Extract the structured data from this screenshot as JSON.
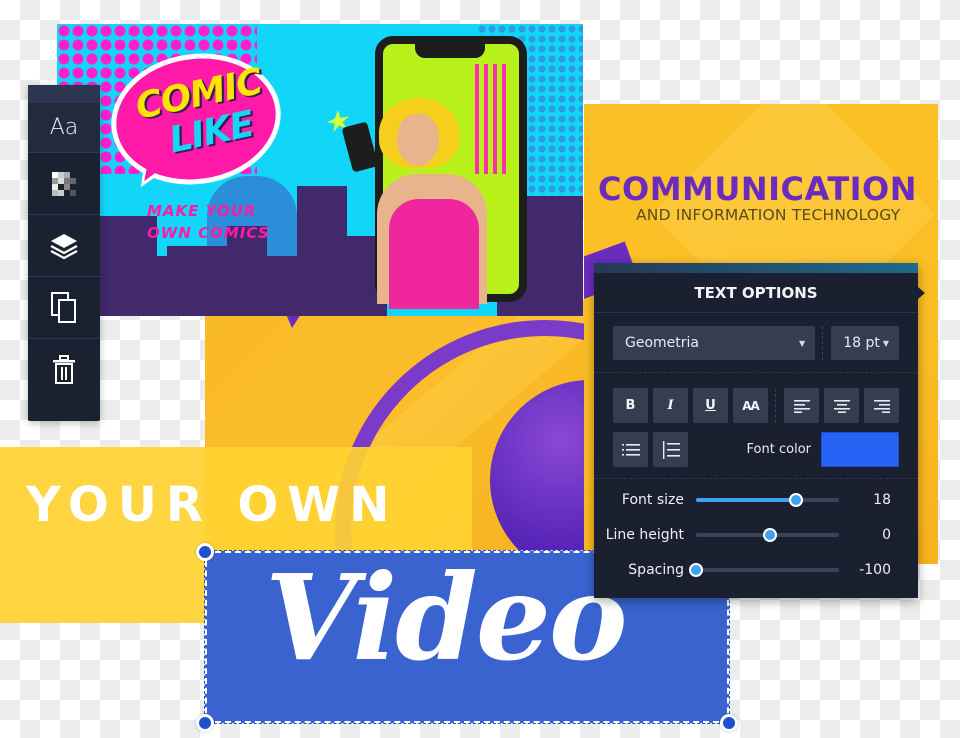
{
  "comic_card": {
    "bubble_line1": "COMIC",
    "bubble_line2": "LIKE",
    "tagline1": "MAKE YOUR",
    "tagline2": "OWN COMICS"
  },
  "communication_card": {
    "title": "COMMUNICATION",
    "subtitle": "AND INFORMATION TECHNOLOGY"
  },
  "toolbar": {
    "items": [
      {
        "name": "text",
        "glyph": "Aa",
        "icon": "text-aa-icon",
        "active": true
      },
      {
        "name": "opacity",
        "icon": "transparency-checker-icon"
      },
      {
        "name": "layers",
        "icon": "layers-icon"
      },
      {
        "name": "duplicate",
        "icon": "copy-icon"
      },
      {
        "name": "delete",
        "icon": "trash-icon"
      }
    ]
  },
  "banner": {
    "text": "YOUR OWN"
  },
  "selection": {
    "text": "Video"
  },
  "text_options": {
    "title": "TEXT OPTIONS",
    "font_family": "Geometria",
    "font_size_select": "18 pt",
    "style_buttons": [
      {
        "name": "bold",
        "label": "B"
      },
      {
        "name": "italic",
        "label": "I"
      },
      {
        "name": "underline",
        "label": "U"
      },
      {
        "name": "uppercase",
        "label": "AA"
      }
    ],
    "align_buttons": [
      "align-left",
      "align-center",
      "align-right"
    ],
    "list_buttons": [
      "bullet-list",
      "numbered-list"
    ],
    "font_color_label": "Font color",
    "font_color": "#2563f5",
    "sliders": [
      {
        "name": "font-size",
        "label": "Font size",
        "value": "18",
        "fraction": 0.7
      },
      {
        "name": "line-height",
        "label": "Line height",
        "value": "0",
        "fraction": 0.52
      },
      {
        "name": "spacing",
        "label": "Spacing",
        "value": "-100",
        "fraction": 0.0
      }
    ]
  }
}
